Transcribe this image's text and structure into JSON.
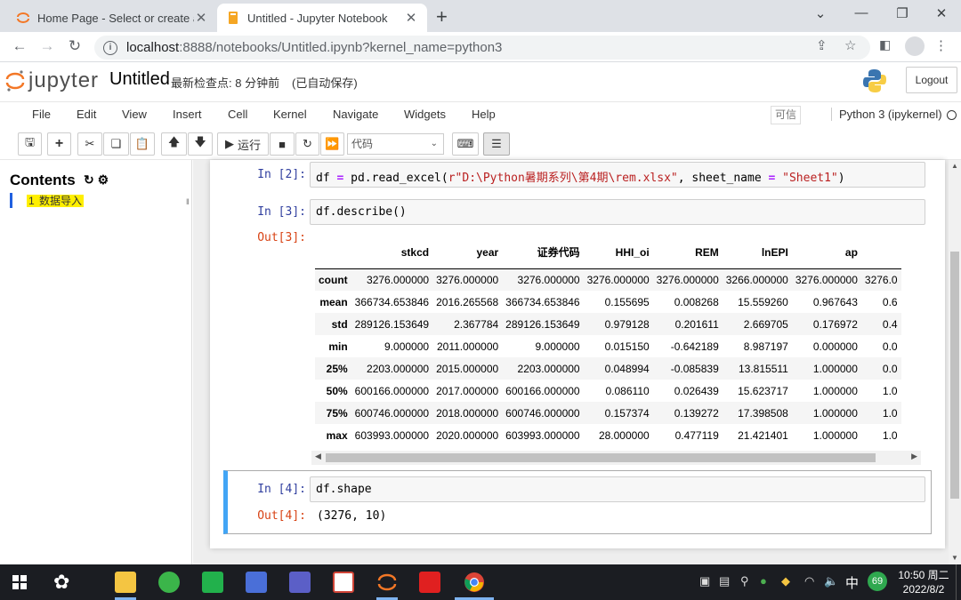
{
  "browser": {
    "tabs": [
      {
        "title": "Home Page - Select or create a",
        "active": false
      },
      {
        "title": "Untitled - Jupyter Notebook",
        "active": true
      }
    ],
    "new_tab": "+",
    "url_host": "localhost",
    "url_rest": ":8888/notebooks/Untitled.ipynb?kernel_name=python3"
  },
  "jupyter": {
    "logo_text": "jupyter",
    "notebook_name": "Untitled",
    "checkpoint": "最新检查点: 8 分钟前",
    "autosave": "(已自动保存)",
    "logout": "Logout",
    "menu": [
      "File",
      "Edit",
      "View",
      "Insert",
      "Cell",
      "Kernel",
      "Navigate",
      "Widgets",
      "Help"
    ],
    "trusted": "可信",
    "kernel": "Python 3 (ipykernel)",
    "run_label": "运行",
    "cell_type": "代码"
  },
  "toc": {
    "title": "Contents",
    "items": [
      {
        "number": "1",
        "label": "数据导入"
      }
    ]
  },
  "cells": [
    {
      "in_prompt": "In  [2]:",
      "code_parts": [
        "df ",
        "=",
        " pd.read_excel(",
        "r\"D:\\Python暑期系列\\第4期\\rem.xlsx\"",
        ", sheet_name ",
        "=",
        " ",
        "\"Sheet1\"",
        ")"
      ]
    },
    {
      "in_prompt": "In  [3]:",
      "code": "df.describe()",
      "out_prompt": "Out[3]:"
    },
    {
      "in_prompt": "In  [4]:",
      "code": "df.shape",
      "out_prompt": "Out[4]:",
      "output": "(3276, 10)"
    }
  ],
  "describe_table": {
    "columns": [
      "stkcd",
      "year",
      "证券代码",
      "HHI_oi",
      "REM",
      "lnEPI",
      "ap",
      ""
    ],
    "rows": [
      {
        "index": "count",
        "values": [
          "3276.000000",
          "3276.000000",
          "3276.000000",
          "3276.000000",
          "3276.000000",
          "3266.000000",
          "3276.000000",
          "3276.0"
        ]
      },
      {
        "index": "mean",
        "values": [
          "366734.653846",
          "2016.265568",
          "366734.653846",
          "0.155695",
          "0.008268",
          "15.559260",
          "0.967643",
          "0.6"
        ]
      },
      {
        "index": "std",
        "values": [
          "289126.153649",
          "2.367784",
          "289126.153649",
          "0.979128",
          "0.201611",
          "2.669705",
          "0.176972",
          "0.4"
        ]
      },
      {
        "index": "min",
        "values": [
          "9.000000",
          "2011.000000",
          "9.000000",
          "0.015150",
          "-0.642189",
          "8.987197",
          "0.000000",
          "0.0"
        ]
      },
      {
        "index": "25%",
        "values": [
          "2203.000000",
          "2015.000000",
          "2203.000000",
          "0.048994",
          "-0.085839",
          "13.815511",
          "1.000000",
          "0.0"
        ]
      },
      {
        "index": "50%",
        "values": [
          "600166.000000",
          "2017.000000",
          "600166.000000",
          "0.086110",
          "0.026439",
          "15.623717",
          "1.000000",
          "1.0"
        ]
      },
      {
        "index": "75%",
        "values": [
          "600746.000000",
          "2018.000000",
          "600746.000000",
          "0.157374",
          "0.139272",
          "17.398508",
          "1.000000",
          "1.0"
        ]
      },
      {
        "index": "max",
        "values": [
          "603993.000000",
          "2020.000000",
          "603993.000000",
          "28.000000",
          "0.477119",
          "21.421401",
          "1.000000",
          "1.0"
        ]
      }
    ]
  },
  "taskbar": {
    "ime": "中",
    "badge": "69",
    "time": "10:50 周二",
    "date": "2022/8/2"
  }
}
